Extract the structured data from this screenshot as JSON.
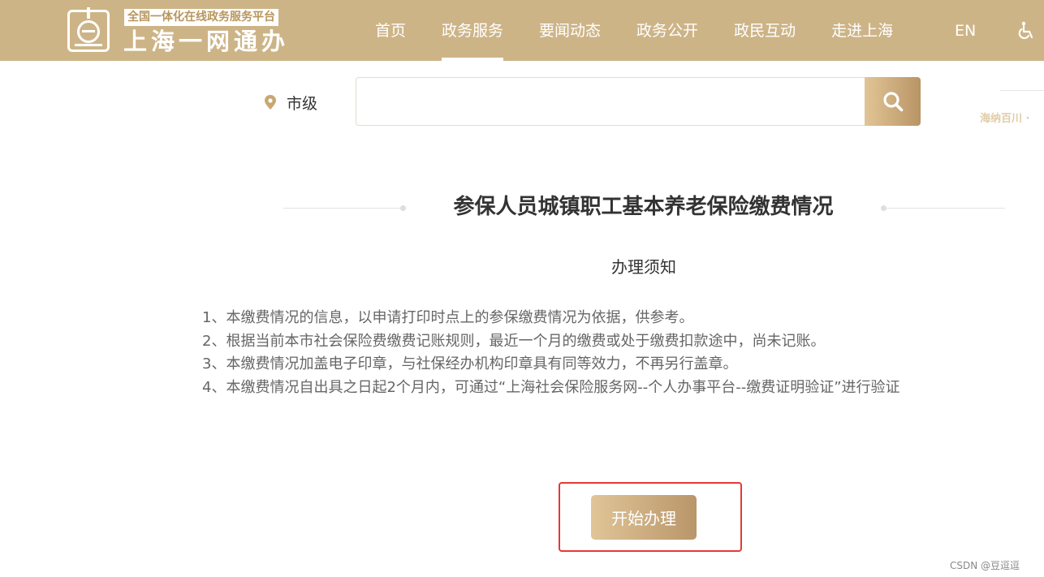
{
  "header": {
    "logo_tagline": "全国一体化在线政务服务平台",
    "logo_name": "上海一网通办",
    "logo_icon": "e-emblem-icon",
    "nav": [
      {
        "label": "首页",
        "active": false
      },
      {
        "label": "政务服务",
        "active": true
      },
      {
        "label": "要闻动态",
        "active": false
      },
      {
        "label": "政务公开",
        "active": false
      },
      {
        "label": "政民互动",
        "active": false
      },
      {
        "label": "走进上海",
        "active": false
      }
    ],
    "language_label": "EN",
    "accessibility_icon": "wheelchair-icon"
  },
  "search": {
    "region_icon": "map-pin-icon",
    "region_label": "市级",
    "value": "",
    "placeholder": "",
    "button_icon": "search-icon"
  },
  "side_slogan": "海纳百川 ·",
  "main": {
    "title": "参保人员城镇职工基本养老保险缴费情况",
    "notice_title": "办理须知",
    "notice_items": [
      "1、本缴费情况的信息，以申请打印时点上的参保缴费情况为依据，供参考。",
      "2、根据当前本市社会保险费缴费记账规则，最近一个月的缴费或处于缴费扣款途中，尚未记账。",
      "3、本缴费情况加盖电子印章，与社保经办机构印章具有同等效力，不再另行盖章。",
      "4、本缴费情况自出具之日起2个月内，可通过“上海社会保险服务网--个人办事平台--缴费证明验证”进行验证"
    ],
    "start_button_label": "开始办理"
  },
  "watermark": "CSDN @豆逗逗",
  "colors": {
    "header_bg": "#cdb487",
    "button_gradient_start": "#e0c597",
    "button_gradient_end": "#b9966a",
    "highlight": "#e53935"
  }
}
